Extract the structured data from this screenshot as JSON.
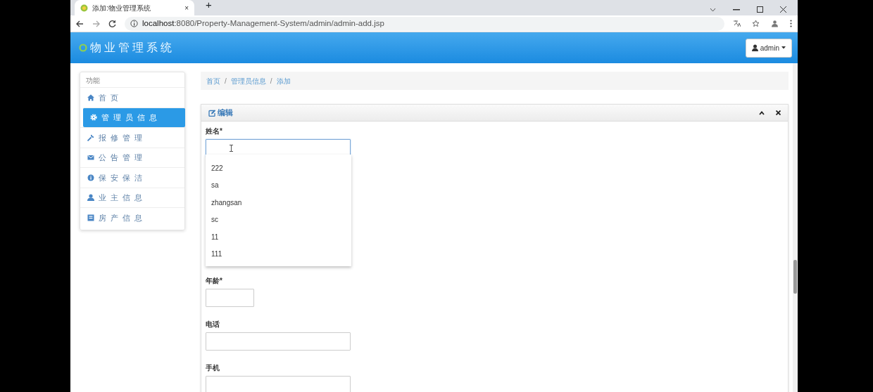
{
  "browser": {
    "tab_title": "添加:物业管理系统",
    "new_tab": "+",
    "close_tab": "×",
    "url_host": "localhost",
    "url_rest": ":8080/Property-Management-System/admin/admin-add.jsp"
  },
  "header": {
    "title": "物业管理系统",
    "user_button": "admin"
  },
  "sidebar": {
    "heading": "功能",
    "items": [
      {
        "label": "首页",
        "selected": false
      },
      {
        "label": "管理员信息",
        "selected": true
      },
      {
        "label": "报修管理",
        "selected": false
      },
      {
        "label": "公告管理",
        "selected": false
      },
      {
        "label": "保安保洁",
        "selected": false
      },
      {
        "label": "业主信息",
        "selected": false
      },
      {
        "label": "房产信息",
        "selected": false
      }
    ]
  },
  "breadcrumb": [
    "首页",
    "管理员信息",
    "添加"
  ],
  "breadcrumb_separator": "/",
  "panel": {
    "title": "编辑"
  },
  "form": {
    "fields": [
      {
        "label": "姓名*",
        "kind": "wide",
        "focused": true
      },
      {
        "label": "年龄*",
        "kind": "short",
        "focused": false
      },
      {
        "label": "电话",
        "kind": "wide",
        "focused": false
      },
      {
        "label": "手机",
        "kind": "wide",
        "focused": false
      }
    ]
  },
  "autocomplete": {
    "items": [
      "222",
      "sa",
      "zhangsan",
      "sc",
      "11",
      "111"
    ]
  }
}
